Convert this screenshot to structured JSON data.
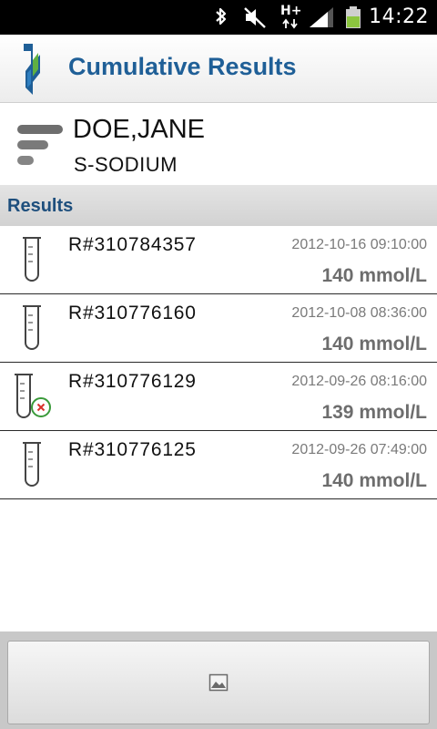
{
  "status_bar": {
    "icons": [
      "bluetooth-icon",
      "mute-icon",
      "hplus-data-icon",
      "signal-icon",
      "battery-icon"
    ],
    "network_label": "H+",
    "time": "14:22"
  },
  "app": {
    "title": "Cumulative Results",
    "logo": "lab-logo"
  },
  "patient": {
    "name": "DOE,JANE",
    "test": "S-SODIUM",
    "icon": "patient-summary-icon"
  },
  "section": {
    "title": "Results"
  },
  "results": [
    {
      "id": "R#310784357",
      "datetime": "2012-10-16 09:10:00",
      "value": "140 mmol/L",
      "rejected": false
    },
    {
      "id": "R#310776160",
      "datetime": "2012-10-08 08:36:00",
      "value": "140 mmol/L",
      "rejected": false
    },
    {
      "id": "R#310776129",
      "datetime": "2012-09-26 08:16:00",
      "value": "139 mmol/L",
      "rejected": true
    },
    {
      "id": "R#310776125",
      "datetime": "2012-09-26 07:49:00",
      "value": "140 mmol/L",
      "rejected": false
    }
  ],
  "bottom": {
    "graph_button_icon": "graph-image-icon"
  },
  "colors": {
    "title_blue": "#1f5f97",
    "section_blue": "#1e4f7d",
    "value_gray": "#6d6d6d",
    "reject_green": "#3a9a3a",
    "reject_red": "#d9302c",
    "battery_green": "#8cc63f"
  }
}
